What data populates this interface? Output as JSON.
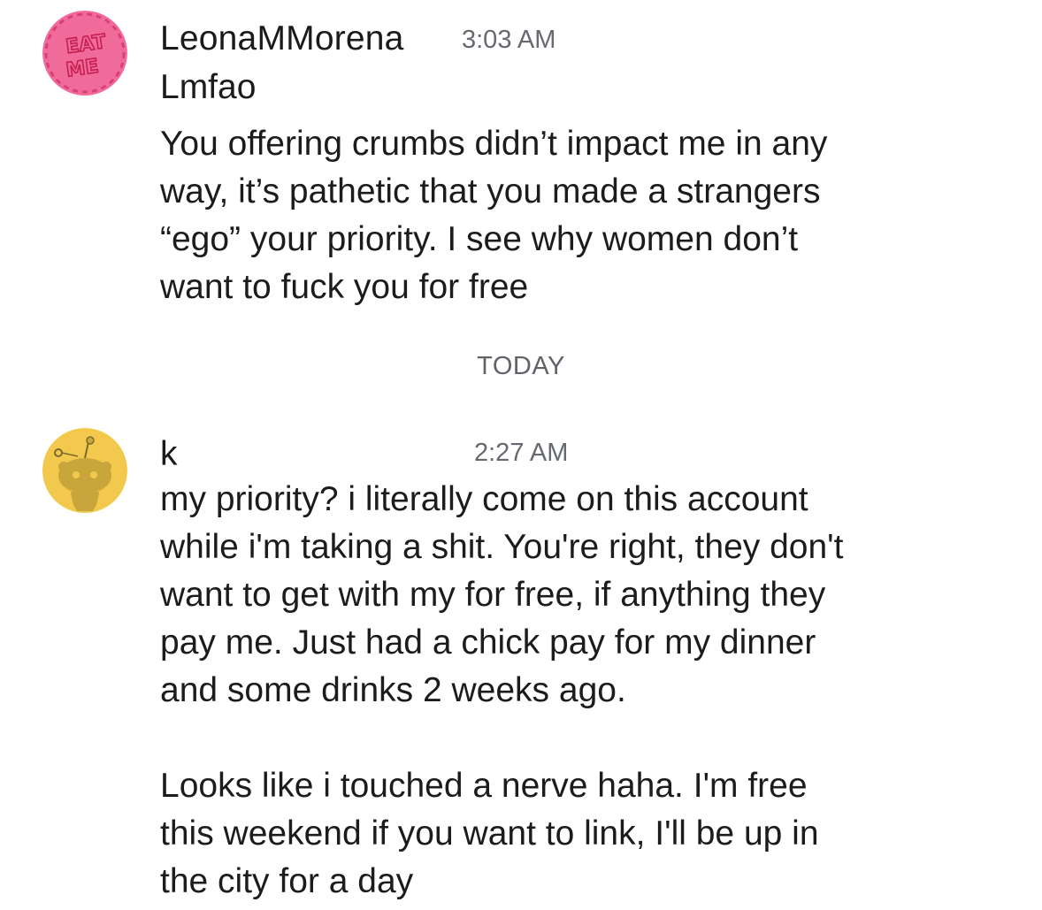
{
  "messages": [
    {
      "username": "LeonaMMorena",
      "timestamp": "3:03 AM",
      "avatar_text_line1": "EAT",
      "avatar_text_line2": "ME",
      "avatar_color": "#f06b9a",
      "lines": [
        "Lmfao",
        "You offering crumbs didn’t impact me in any\nway, it’s pathetic that you made a strangers\n“ego” your priority. I see why women don’t\nwant to fuck you for free"
      ]
    },
    {
      "username": "k",
      "timestamp": "2:27 AM",
      "avatar_color": "#f2c94c",
      "lines": [
        "my priority? i literally come on this account\nwhile i'm taking a shit. You're right, they don't\nwant to get with my for free, if anything they\npay me. Just had a chick pay for my dinner\nand some drinks 2 weeks ago.\n\nLooks like i touched a nerve haha. I'm free\nthis weekend if you want to link, I'll be up in\nthe city for a day"
      ]
    }
  ],
  "divider_label": "TODAY"
}
